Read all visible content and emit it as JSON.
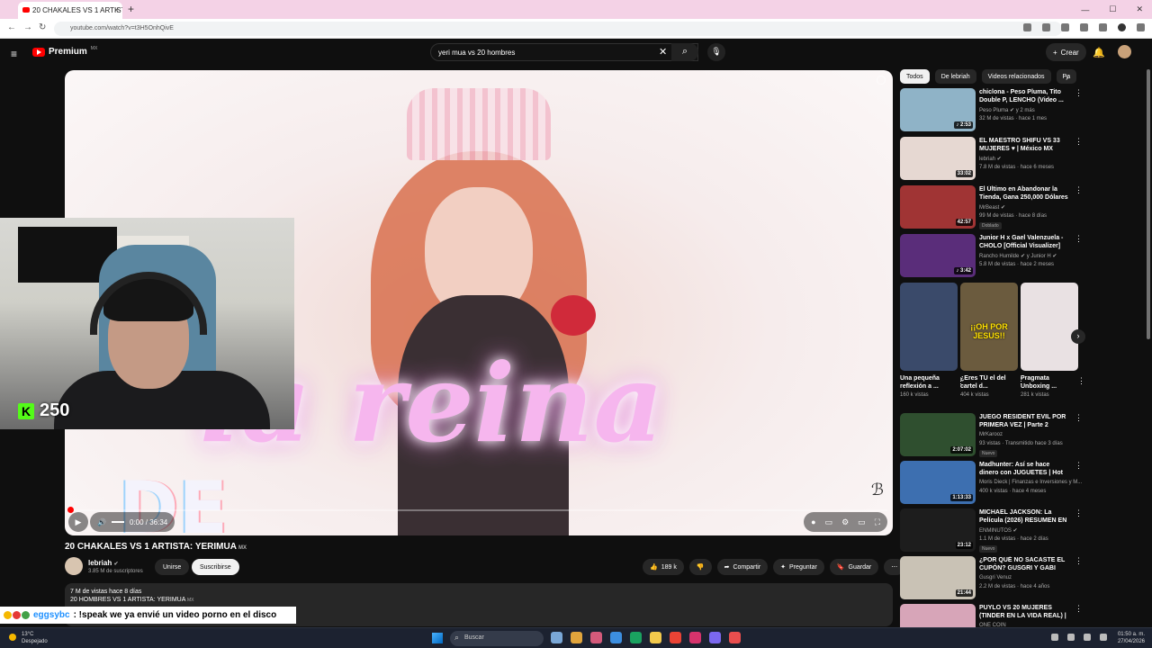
{
  "browser": {
    "tab_title": "20 CHAKALES VS 1 ARTISTA",
    "tab_close": "×",
    "new_tab": "+",
    "window_controls": [
      "—",
      "☐",
      "✕"
    ],
    "nav": [
      "←",
      "→",
      "↻"
    ],
    "url": "youtube.com/watch?v=t3H5OnhQivE"
  },
  "yt_header": {
    "menu_icon": "≡",
    "logo_text": "Premium",
    "logo_region": "MX",
    "search_value": "yeri mua vs 20 hombres",
    "clear_icon": "✕",
    "search_icon": "⌕",
    "mic_icon": "🎙",
    "create_label": "Crear",
    "create_icon": "+",
    "bell_icon": "🔔"
  },
  "player": {
    "overlay_text": "la reina",
    "overlay_text2": "DE",
    "watermark": "ℬ",
    "time": "0:00 / 36:34",
    "play_icon": "▶",
    "volume_icon": "🔊",
    "ctrl_icons": [
      "●",
      "▭",
      "⚙",
      "▭",
      "⛶"
    ]
  },
  "stream": {
    "kick_logo": "K",
    "kick_count": "250"
  },
  "video": {
    "title": "20 CHAKALES VS 1 ARTISTA: YERIMUA",
    "title_badge": "MX",
    "channel": "lebriah",
    "verified": "✔",
    "subs": "3.85 M de suscriptores",
    "join": "Unirse",
    "subscribe": "Suscribirse",
    "likes": "189 k",
    "like_icon": "👍",
    "dislike_icon": "👎",
    "share": "Compartir",
    "share_icon": "➦",
    "ask": "Preguntar",
    "ask_icon": "✦",
    "save": "Guardar",
    "save_icon": "🔖",
    "more_icon": "⋯",
    "desc_stats": "7 M de vistas  hace 8 días",
    "desc_line": "20 HOMBRES VS 1 ARTISTA: YERIMUA",
    "desc_badge": "MX"
  },
  "chat": {
    "user": "eggsybc",
    "message": ": !speak we ya envié un video porno en el disco"
  },
  "chips": [
    "Todos",
    "De lebriah",
    "Videos relacionados",
    "Pa"
  ],
  "chip_next": "›",
  "recommendations": [
    {
      "title": "chiclona - Peso Pluma, Tito Double P, LENCHO (Video ...",
      "channel": "Peso Pluma ✔ y 2 más",
      "views": "32 M de vistas · hace 1 mes",
      "duration": "♪ 2:53",
      "thumb": "#8fb3c7"
    },
    {
      "title": "EL MAESTRO SHIFU VS 33 MUJERES ♥ | México MX",
      "channel": "lebriah ✔",
      "views": "7.8 M de vistas · hace 6 meses",
      "duration": "33:02",
      "thumb": "#e6d8d2"
    },
    {
      "title": "El Último en Abandonar la Tienda, Gana 250,000 Dólares",
      "channel": "MrBeast ✔",
      "views": "99 M de vistas · hace 8 días",
      "duration": "42:57",
      "badge": "Doblado",
      "thumb": "#a03434"
    },
    {
      "title": "Junior H x Gael Valenzuela - CHOLO [Official Visualizer]",
      "channel": "Rancho Humilde ✔ y Junior H ✔",
      "views": "5.8 M de vistas · hace 2 meses",
      "duration": "♪ 3:42",
      "thumb": "#5a2d7a"
    }
  ],
  "shorts": [
    {
      "title": "Una pequeña reflexión a ...",
      "views": "160 k vistas",
      "thumb": "#3a4a6a"
    },
    {
      "title": "¿Eres TÚ el del cartel d...",
      "views": "404 k vistas",
      "thumb": "#6b5b3e",
      "overlay": "¡¡OH POR JESUS!!"
    },
    {
      "title": "Pragmata Unboxing ...",
      "views": "281 k vistas",
      "thumb": "#e9e1e3"
    }
  ],
  "recommendations2": [
    {
      "title": "JUEGO RESIDENT EVIL POR PRIMERA VEZ | Parte 2",
      "channel": "MrKarooz",
      "views": "93 vistas · Transmitido hace 3 días",
      "duration": "2:07:02",
      "badge": "Nuevo",
      "thumb": "#2f4f2f"
    },
    {
      "title": "Madhunter: Así se hace dinero con JUGUETES | Hot Wheels, ...",
      "channel": "Moris Dieck | Finanzas e Inversiones y M...",
      "views": "400 k vistas · hace 4 meses",
      "duration": "1:13:33",
      "thumb": "#3d6fb0"
    },
    {
      "title": "MICHAEL JACKSON: La Película (2026) RESUMEN EN MINUTOS",
      "channel": "ENMINUTOS ✔",
      "views": "1.1 M de vistas · hace 2 días",
      "duration": "23:12",
      "badge": "Nuevo",
      "thumb": "#1d1d1d"
    },
    {
      "title": "¿POR QUÉ NO SACASTE EL CUPÓN? GUSGRI Y GABI",
      "channel": "Gusgri Venuz",
      "views": "2.2 M de vistas · hace 4 años",
      "duration": "21:44",
      "thumb": "#c9c2b5"
    },
    {
      "title": "PUYLO VS 20 MUJERES (TINDER EN LA VIDA REAL) | ...",
      "channel": "ONE COIN",
      "views": "",
      "duration": "",
      "thumb": "#d7a5b8"
    }
  ],
  "menu_dots": "⋮",
  "taskbar": {
    "temp": "13°C",
    "weather": "Despejado",
    "search": "Buscar",
    "time": "01:50 a. m.",
    "date": "27/04/2026",
    "apps": [
      "#7aa7d6",
      "#e0a43c",
      "#d45a7b",
      "#3c8ee0",
      "#1aa260",
      "#f2c94c",
      "#ea4335",
      "#d6336c",
      "#7b68ee",
      "#e94e4e"
    ]
  }
}
